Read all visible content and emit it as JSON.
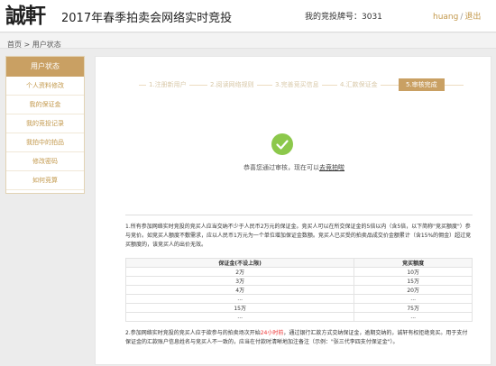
{
  "header": {
    "logo_text": "誠軒",
    "title": "2017年春季拍卖会网络实时竞投",
    "bidder_label": "我的竞投牌号：3031",
    "username": "huang",
    "separator": "/",
    "logout": "退出"
  },
  "breadcrumb": {
    "text": "首页 > 用户状态"
  },
  "sidebar": {
    "title": "用户状态",
    "items": [
      {
        "label": "个人资料修改"
      },
      {
        "label": "我的保证金"
      },
      {
        "label": "我的竞投记录"
      },
      {
        "label": "我拍中的拍品"
      },
      {
        "label": "修改密码"
      },
      {
        "label": "如何竞算"
      }
    ]
  },
  "steps": [
    {
      "label": "1.注册新用户"
    },
    {
      "label": "2.阅读网络规则"
    },
    {
      "label": "3.完善竞买信息"
    },
    {
      "label": "4.汇款保证金"
    },
    {
      "label": "5.审核完成"
    }
  ],
  "success": {
    "message": "恭喜您通过审核，现在可以",
    "link": "去竞拍啦"
  },
  "notes": {
    "note1": "1.所有参加网络实时竞投的竞买人应当交纳不少于人民币2万元的保证金。竞买人可以在所交保证金的5倍以内（含5倍，以下简称\"竞买额度\"）参与竞价。如竞买人额度不敷需求，应以人民币1万元为一个单位增加保证金数额。竞买人已买受的拍卖品成交价金额累计（含15%的佣金）超过竞买额度的，该竞买人的出价无效。",
    "table": {
      "headers": [
        "保证金(不设上限)",
        "竞买额度"
      ],
      "rows": [
        [
          "2万",
          "10万"
        ],
        [
          "3万",
          "15万"
        ],
        [
          "4万",
          "20万"
        ],
        [
          "...",
          "..."
        ],
        [
          "15万",
          "75万"
        ],
        [
          "...",
          "..."
        ]
      ]
    },
    "note2_a": "2.参加网络实时竞投的竞买人应于欲参与的拍卖场次开始",
    "note2_red": "24小时前",
    "note2_b": "，通过银行汇款方式交纳保证金，逾期交纳的，诚轩有权拒绝竞买。用于支付保证金的汇款账户信息姓名与竞买人不一致的，应当在付款时清晰地加注备注（示例：\"张三代李四支付保证金\"）。"
  },
  "colors": {
    "accent": "#c9a063",
    "link": "#c3994d",
    "success_green": "#8cc84b"
  }
}
